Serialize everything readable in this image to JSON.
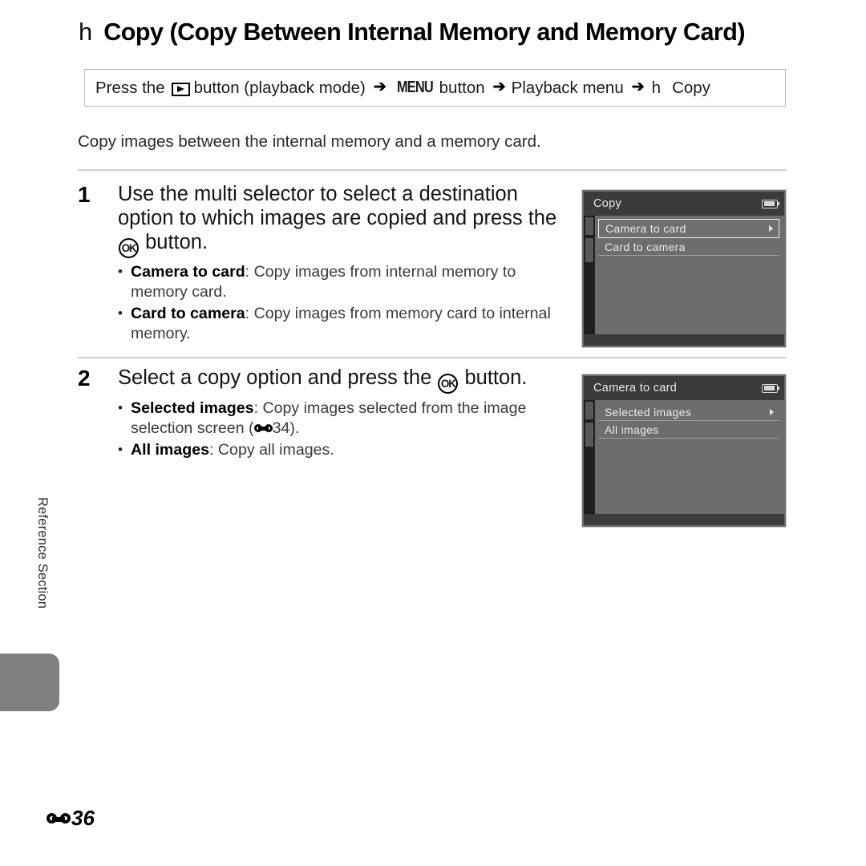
{
  "header": {
    "symbol": "h",
    "title": "Copy (Copy Between Internal Memory and Memory Card)"
  },
  "nav_path": {
    "part1": "Press the",
    "play_icon": "playback-button-icon",
    "part2": "button (playback mode)",
    "arrow": "➔",
    "menu_label": "MENU",
    "part3": "button",
    "part4": "Playback menu",
    "symbol": "h",
    "part5": "Copy"
  },
  "intro": "Copy images between the internal memory and a memory card.",
  "steps": [
    {
      "number": "1",
      "title_before_ok": "Use the multi selector to select a destination option to which images are copied and press the",
      "ok_label": "OK",
      "title_after_ok": "button.",
      "bullets": [
        {
          "term": "Camera to card",
          "sep": ": ",
          "text": "Copy images from internal memory to memory card."
        },
        {
          "term": "Card to camera",
          "sep": ": ",
          "text": "Copy images from memory card to internal memory."
        }
      ]
    },
    {
      "number": "2",
      "title_before_ok": "Select a copy option and press the",
      "ok_label": "OK",
      "title_after_ok": "button.",
      "bullets": [
        {
          "term": "Selected images",
          "sep": ": ",
          "text": "Copy images selected from the image selection screen (",
          "ref_symbol": "E",
          "ref_page": "34",
          "text_tail": ")."
        },
        {
          "term": "All images",
          "sep": ": ",
          "text": "Copy all images."
        }
      ]
    }
  ],
  "screens": [
    {
      "title": "Copy",
      "battery_icon": "battery-icon",
      "rows": [
        {
          "label": "Camera to card",
          "selected": true,
          "caret": true
        },
        {
          "label": "Card to camera",
          "selected": false,
          "caret": false
        }
      ]
    },
    {
      "title": "Camera to card",
      "battery_icon": "battery-icon",
      "rows": [
        {
          "label": "Selected images",
          "selected": false,
          "caret": true
        },
        {
          "label": "All images",
          "selected": false,
          "caret": false
        }
      ]
    }
  ],
  "side_tab": {
    "label": "Reference Section"
  },
  "footer": {
    "symbol": "E",
    "page": "36"
  },
  "colors": {
    "screen_body": "#6d6d6d",
    "screen_header": "#3b3b3b",
    "side_tab": "#808080",
    "rule": "#d2d2d2"
  }
}
